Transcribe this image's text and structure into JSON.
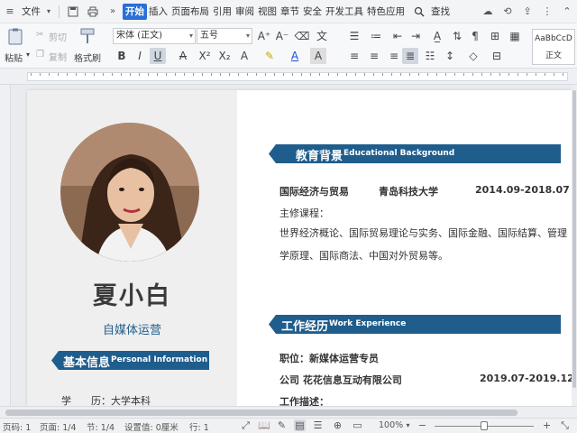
{
  "menubar": {
    "file": "文件",
    "tabs": [
      "开始",
      "插入",
      "页面布局",
      "引用",
      "审阅",
      "视图",
      "章节",
      "安全",
      "开发工具",
      "特色应用"
    ],
    "search": "查找"
  },
  "ribbon": {
    "paste": "粘贴",
    "cut": "剪切",
    "copy": "复制",
    "format_painter": "格式刷",
    "font_name": "宋体 (正文)",
    "font_size": "五号",
    "styles_sample": "AaBbCcD",
    "styles_label": "正文"
  },
  "resume": {
    "name": "夏小白",
    "role": "自媒体运营",
    "basic": {
      "cn": "基本信息",
      "en": "Personal Information"
    },
    "education_label": "学　　历：大学本科",
    "edu_section": {
      "cn": "教育背景",
      "en": "Educational Background"
    },
    "edu": {
      "major": "国际经济与贸易",
      "school": "青岛科技大学",
      "period": "2014.09-2018.07",
      "courses_label": "主修课程：",
      "courses": "世界经济概论、国际贸易理论与实务、国际金融、国际结算、管理学原理、国际商法、中国对外贸易等。"
    },
    "work_section": {
      "cn": "工作经历",
      "en": "Work Experience"
    },
    "work": {
      "position": "职位：新媒体运营专员",
      "company": "公司 花花信息互动有限公司",
      "period": "2019.07-2019.12",
      "desc_label": "工作描述："
    }
  },
  "status": {
    "page": "页码: 1",
    "pages": "页面: 1/4",
    "section": "节: 1/4",
    "setting": "设置值: 0厘米",
    "row": "行: 1",
    "zoom": "100%",
    "zoom_level": 0.5
  },
  "colors": {
    "accent": "#1f5d8c",
    "active_tab": "#2a6fd6"
  }
}
